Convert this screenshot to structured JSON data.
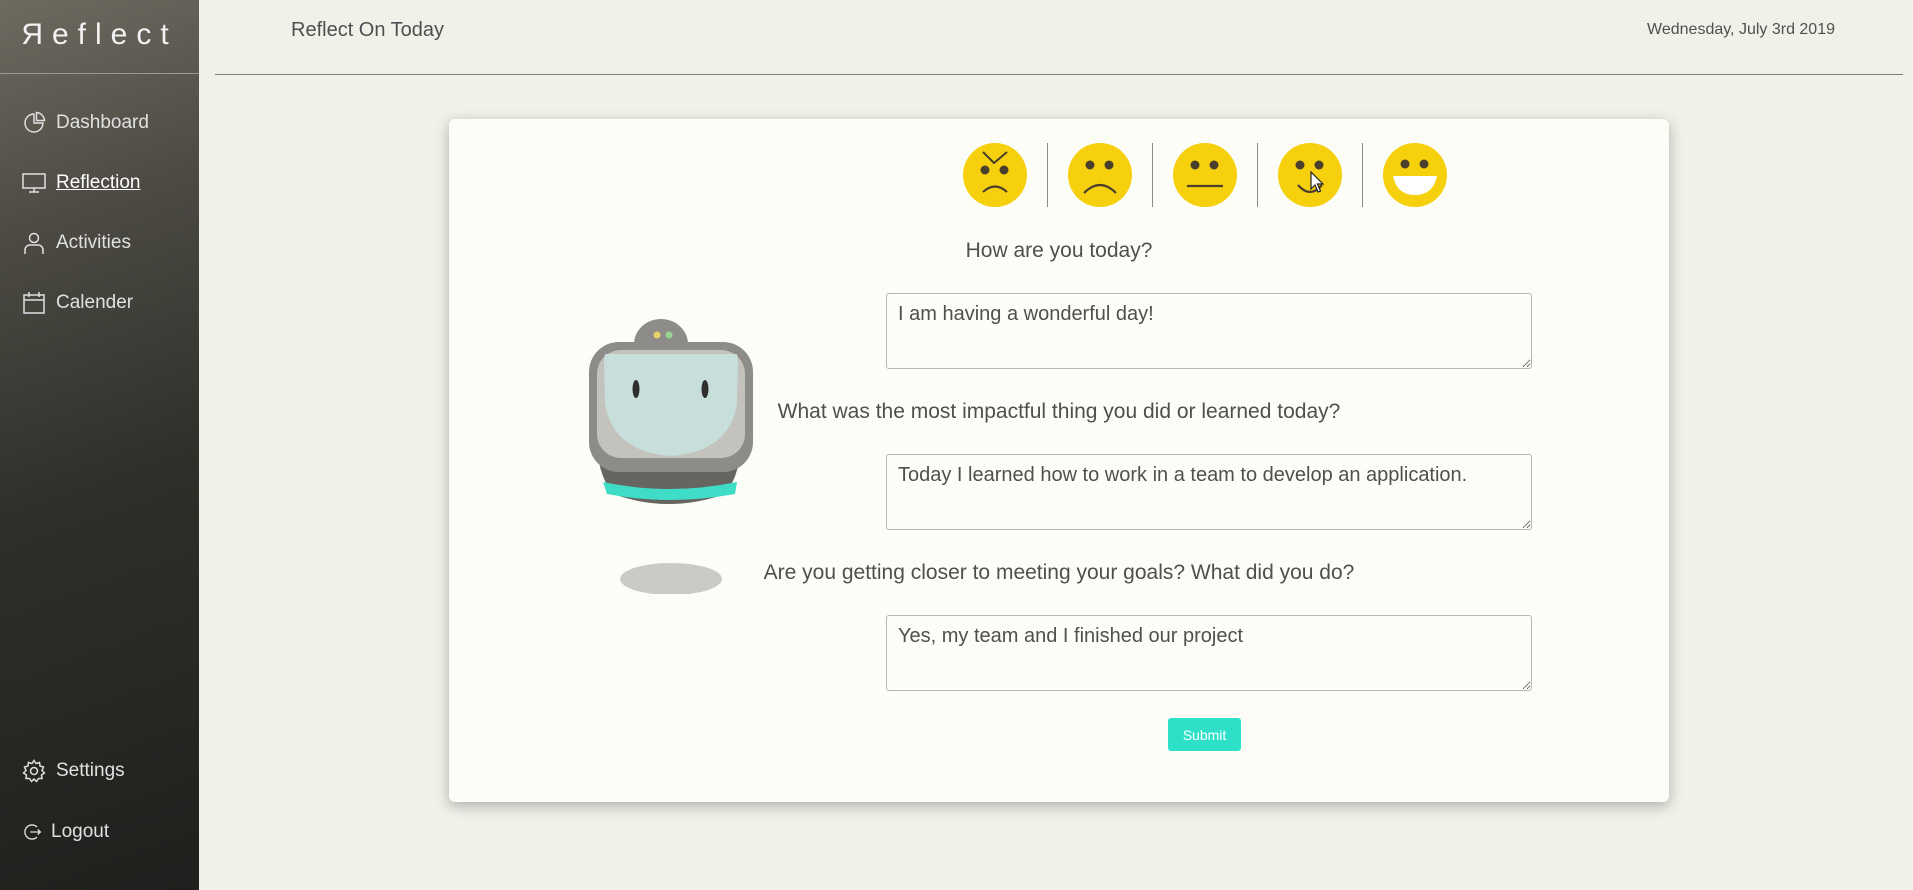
{
  "app": {
    "logo": "Яeflect"
  },
  "sidebar": {
    "items": [
      {
        "label": "Dashboard",
        "icon": "pie-chart-icon"
      },
      {
        "label": "Reflection",
        "icon": "monitor-icon",
        "active": true
      },
      {
        "label": "Activities",
        "icon": "user-icon"
      },
      {
        "label": "Calender",
        "icon": "calendar-icon"
      }
    ],
    "bottom_items": [
      {
        "label": "Settings",
        "icon": "gear-icon"
      },
      {
        "label": "Logout",
        "icon": "logout-icon"
      }
    ]
  },
  "header": {
    "title": "Reflect On Today",
    "date": "Wednesday, July 3rd 2019"
  },
  "moods": [
    "angry-face-icon",
    "sad-face-icon",
    "neutral-face-icon",
    "smirk-face-icon",
    "happy-face-icon"
  ],
  "questions": [
    {
      "label": "How are you today?",
      "answer": "I am having a wonderful day!"
    },
    {
      "label": "What was the most impactful thing you did or learned today?",
      "answer": "Today I learned how to work in a team to develop an application."
    },
    {
      "label": "Are you getting closer to meeting your goals? What did you do?",
      "answer": "Yes, my team and I finished our project"
    }
  ],
  "form": {
    "submit_label": "Submit"
  },
  "colors": {
    "accent": "#2fe0c8",
    "mood": "#f6d00c",
    "sidebar": "#2f2f2a"
  }
}
